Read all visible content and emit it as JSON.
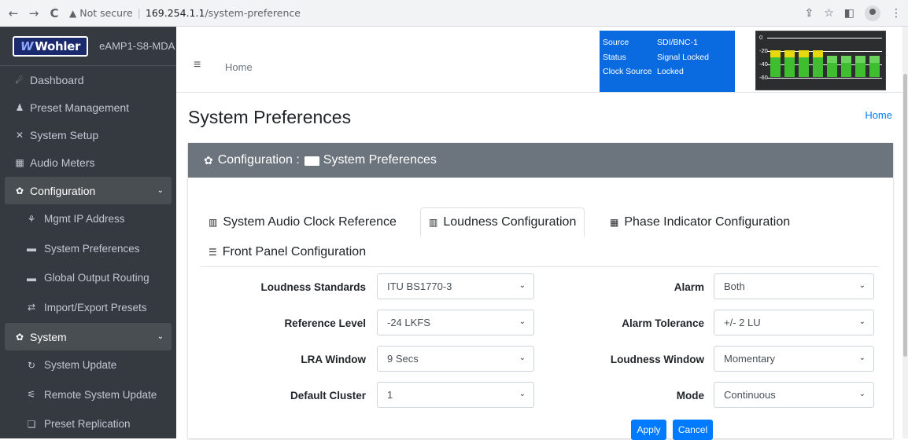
{
  "browser": {
    "back_icon": "←",
    "forward_icon": "→",
    "reload_icon": "C",
    "warning_icon": "▲",
    "security_text": "Not secure",
    "host": "169.254.1.1",
    "path": "/system-preference"
  },
  "sidebar": {
    "logo_w": "W",
    "logo_text": "Wohler",
    "device": "eAMP1-S8-MDA",
    "items": [
      {
        "icon": "☄",
        "label": "Dashboard"
      },
      {
        "icon": "♟",
        "label": "Preset Management"
      },
      {
        "icon": "✕",
        "label": "System Setup"
      },
      {
        "icon": "▦",
        "label": "Audio Meters"
      },
      {
        "icon": "✿",
        "label": "Configuration",
        "chevron": "⌄"
      },
      {
        "icon": "⚘",
        "label": "Mgmt IP Address"
      },
      {
        "icon": "▬",
        "label": "System Preferences"
      },
      {
        "icon": "▬",
        "label": "Global Output Routing"
      },
      {
        "icon": "⇄",
        "label": "Import/Export Presets"
      },
      {
        "icon": "✿",
        "label": "System",
        "chevron": "⌄"
      },
      {
        "icon": "↻",
        "label": "System Update"
      },
      {
        "icon": "⚟",
        "label": "Remote System Update"
      },
      {
        "icon": "❏",
        "label": "Preset Replication"
      }
    ]
  },
  "header": {
    "menu_icon": "≡",
    "home": "Home",
    "status": {
      "source_key": "Source",
      "source_val": "SDI/BNC-1",
      "status_key": "Status",
      "status_val": "Signal Locked",
      "clock_key": "Clock Source",
      "clock_val": "Locked"
    },
    "meter": {
      "labels": [
        "0",
        "-20",
        "-40",
        "-60"
      ],
      "channel_levels": [
        0.9,
        0.9,
        0.9,
        0.9,
        0.7,
        0.7,
        0.7,
        0.7
      ],
      "peak_color": "#e8d90e",
      "level_color": "#3fbf2f"
    }
  },
  "page": {
    "title": "System Preferences",
    "breadcrumb_home": "Home"
  },
  "card": {
    "header_icon": "✿",
    "header_prefix": "Configuration :",
    "header_title": "System Preferences",
    "tabs": [
      {
        "icon": "▥",
        "label": "System Audio Clock Reference"
      },
      {
        "icon": "▥",
        "label": "Loudness Configuration"
      },
      {
        "icon": "▦",
        "label": "Phase Indicator Configuration"
      },
      {
        "icon": "☰",
        "label": "Front Panel Configuration"
      }
    ],
    "left_fields": [
      {
        "label": "Loudness Standards",
        "value": "ITU BS1770-3"
      },
      {
        "label": "Reference Level",
        "value": "-24 LKFS"
      },
      {
        "label": "LRA Window",
        "value": "9 Secs"
      },
      {
        "label": "Default Cluster",
        "value": "1"
      }
    ],
    "right_fields": [
      {
        "label": "Alarm",
        "value": "Both"
      },
      {
        "label": "Alarm Tolerance",
        "value": "+/- 2 LU"
      },
      {
        "label": "Loudness Window",
        "value": "Momentary"
      },
      {
        "label": "Mode",
        "value": "Continuous"
      }
    ],
    "apply": "Apply",
    "cancel": "Cancel",
    "select_arrow": "⌄"
  },
  "colors": {
    "sidebar_bg": "#343a40",
    "accent": "#007bff",
    "status_blue": "#0a6be0",
    "card_header": "#6c757d"
  }
}
